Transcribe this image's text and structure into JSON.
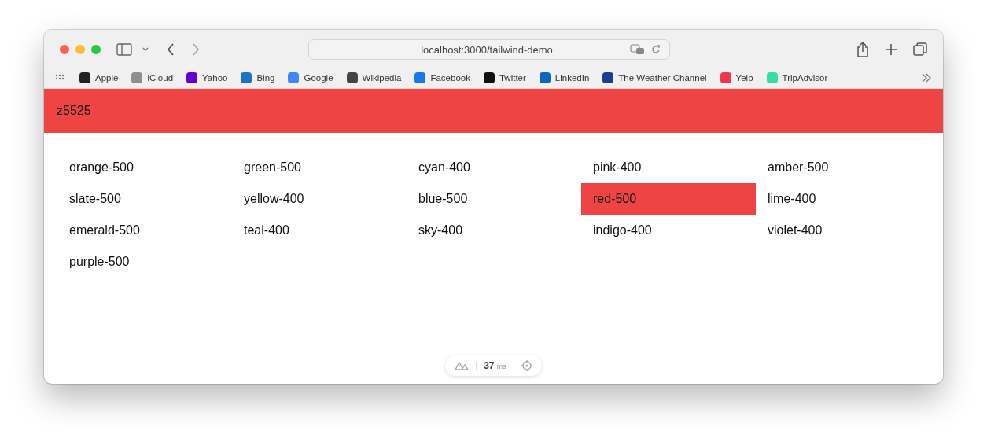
{
  "browser": {
    "url": "localhost:3000/tailwind-demo",
    "bookmarks": [
      {
        "label": "Apple",
        "color": "#222222"
      },
      {
        "label": "iCloud",
        "color": "#8e8e93"
      },
      {
        "label": "Yahoo",
        "color": "#6001d2"
      },
      {
        "label": "Bing",
        "color": "#1a73c8"
      },
      {
        "label": "Google",
        "color": "#4285f4"
      },
      {
        "label": "Wikipedia",
        "color": "#444444"
      },
      {
        "label": "Facebook",
        "color": "#1877f2"
      },
      {
        "label": "Twitter",
        "color": "#111111"
      },
      {
        "label": "LinkedIn",
        "color": "#0a66c2"
      },
      {
        "label": "The Weather Channel",
        "color": "#1b3f94"
      },
      {
        "label": "Yelp",
        "color": "#f0364b"
      },
      {
        "label": "TripAdvisor",
        "color": "#34e0a1"
      }
    ]
  },
  "header": {
    "title": "z5525"
  },
  "colors": [
    {
      "label": "orange-500",
      "selected": false
    },
    {
      "label": "green-500",
      "selected": false
    },
    {
      "label": "cyan-400",
      "selected": false
    },
    {
      "label": "pink-400",
      "selected": false
    },
    {
      "label": "amber-500",
      "selected": false
    },
    {
      "label": "slate-500",
      "selected": false
    },
    {
      "label": "yellow-400",
      "selected": false
    },
    {
      "label": "blue-500",
      "selected": false
    },
    {
      "label": "red-500",
      "selected": true
    },
    {
      "label": "lime-400",
      "selected": false
    },
    {
      "label": "emerald-500",
      "selected": false
    },
    {
      "label": "teal-400",
      "selected": false
    },
    {
      "label": "sky-400",
      "selected": false
    },
    {
      "label": "indigo-400",
      "selected": false
    },
    {
      "label": "violet-400",
      "selected": false
    },
    {
      "label": "purple-500",
      "selected": false
    }
  ],
  "devtools": {
    "time": "37",
    "unit": "ms"
  }
}
